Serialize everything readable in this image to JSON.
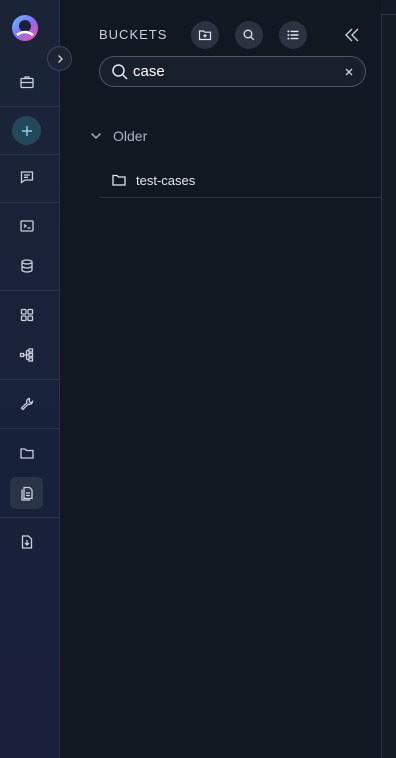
{
  "rail": {
    "items": [
      {
        "name": "briefcase-icon"
      },
      {
        "name": "add-icon"
      },
      {
        "name": "chat-icon"
      },
      {
        "name": "terminal-icon"
      },
      {
        "name": "database-icon"
      },
      {
        "name": "grid-icon"
      },
      {
        "name": "workflow-icon"
      },
      {
        "name": "wrench-icon"
      },
      {
        "name": "folder-icon"
      },
      {
        "name": "documents-icon",
        "active": true
      },
      {
        "name": "file-download-icon"
      }
    ]
  },
  "panel": {
    "title": "BUCKETS",
    "header_buttons": [
      "new-folder-icon",
      "search-icon",
      "list-icon"
    ],
    "search": {
      "value": "case",
      "placeholder": ""
    },
    "group": {
      "label": "Older",
      "expanded": true
    },
    "items": [
      {
        "label": "test-cases",
        "icon": "folder-icon"
      }
    ]
  },
  "colors": {
    "background": "#121821",
    "accent_add": "#23485a",
    "text": "#c9d2de"
  }
}
